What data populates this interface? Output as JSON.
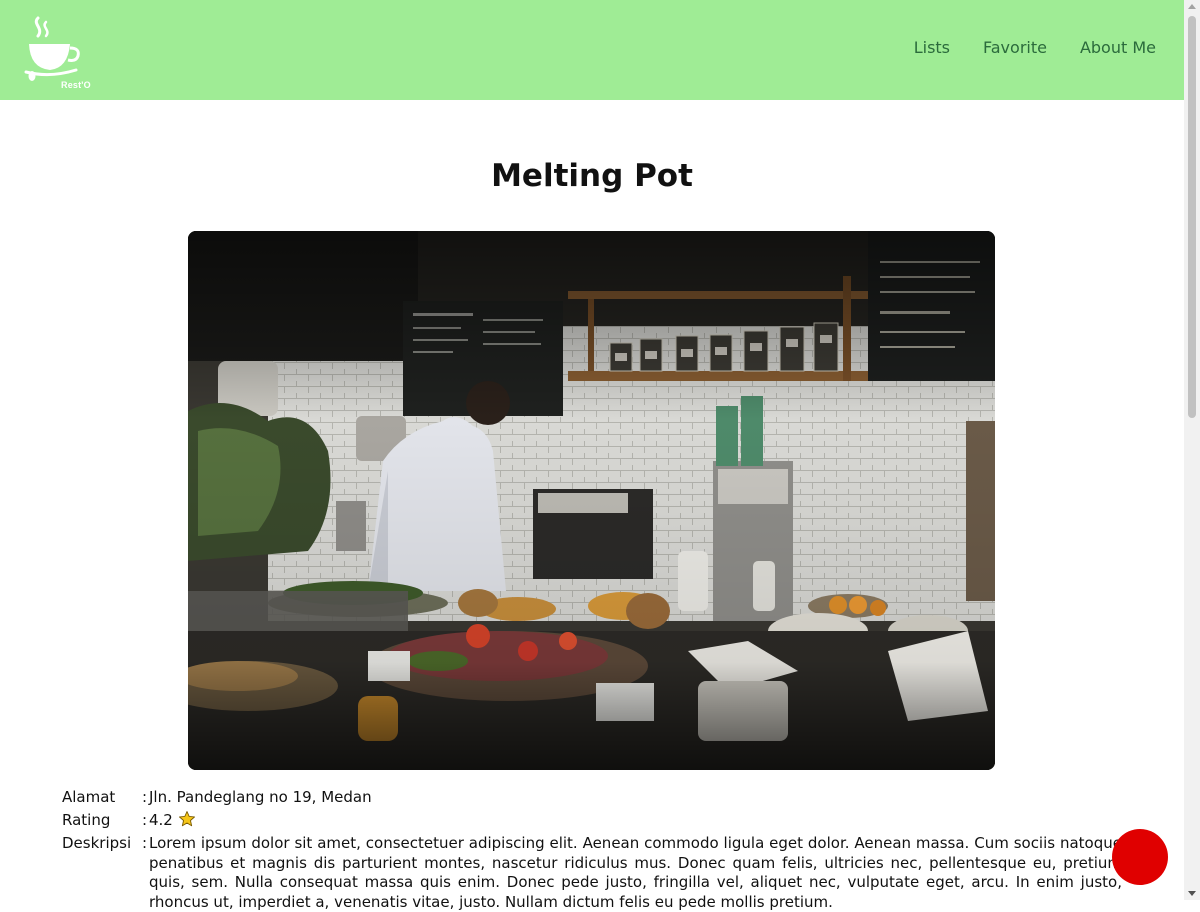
{
  "header": {
    "logo_text": "Rest'O",
    "nav": [
      {
        "label": "Lists"
      },
      {
        "label": "Favorite"
      },
      {
        "label": "About Me"
      }
    ]
  },
  "restaurant": {
    "name": "Melting Pot",
    "address_label": "Alamat",
    "address": "Jln. Pandeglang no 19, Medan",
    "rating_label": "Rating",
    "rating": "4.2",
    "description_label": "Deskripsi",
    "description": "Lorem ipsum dolor sit amet, consectetuer adipiscing elit. Aenean commodo ligula eget dolor. Aenean massa. Cum sociis natoque penatibus et magnis dis parturient montes, nascetur ridiculus mus. Donec quam felis, ultricies nec, pellentesque eu, pretium quis, sem. Nulla consequat massa quis enim. Donec pede justo, fringilla vel, aliquet nec, vulputate eget, arcu. In enim justo, rhoncus ut, imperdiet a, venenatis vitae, justo. Nullam dictum felis eu pede mollis pretium."
  },
  "icons": {
    "rating": "star-icon",
    "logo": "coffee-cup-icon"
  },
  "colors": {
    "header_bg": "#9fec95",
    "nav_text": "#2b6b3c",
    "fab": "#e00000",
    "star": "#f5c518"
  }
}
